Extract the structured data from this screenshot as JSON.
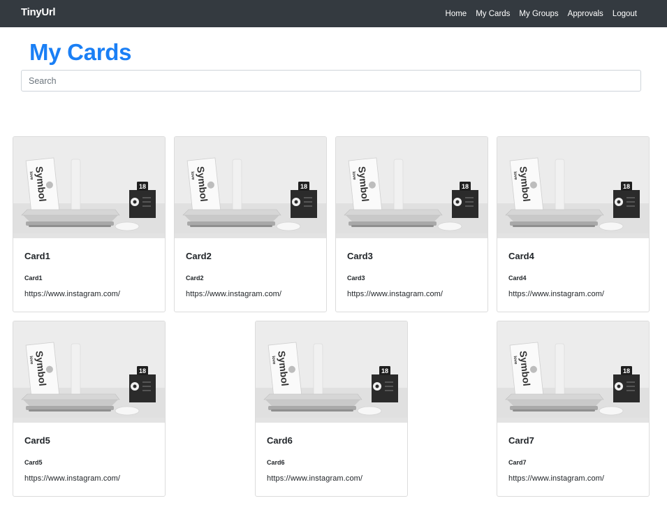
{
  "navbar": {
    "brand": "TinyUrl",
    "links": [
      "Home",
      "My Cards",
      "My Groups",
      "Approvals",
      "Logout"
    ]
  },
  "page": {
    "title": "My Cards"
  },
  "search": {
    "placeholder": "Search",
    "value": ""
  },
  "cards": [
    {
      "title": "Card1",
      "subtitle": "Card1",
      "url": "https://www.instagram.com/"
    },
    {
      "title": "Card2",
      "subtitle": "Card2",
      "url": "https://www.instagram.com/"
    },
    {
      "title": "Card3",
      "subtitle": "Card3",
      "url": "https://www.instagram.com/"
    },
    {
      "title": "Card4",
      "subtitle": "Card4",
      "url": "https://www.instagram.com/"
    },
    {
      "title": "Card5",
      "subtitle": "Card5",
      "url": "https://www.instagram.com/"
    },
    {
      "title": "Card6",
      "subtitle": "Card6",
      "url": "https://www.instagram.com/"
    },
    {
      "title": "Card7",
      "subtitle": "Card7",
      "url": "https://www.instagram.com/"
    }
  ],
  "image": {
    "book_text": "Symbol",
    "book_small_text": "love",
    "badge_number": "18"
  }
}
